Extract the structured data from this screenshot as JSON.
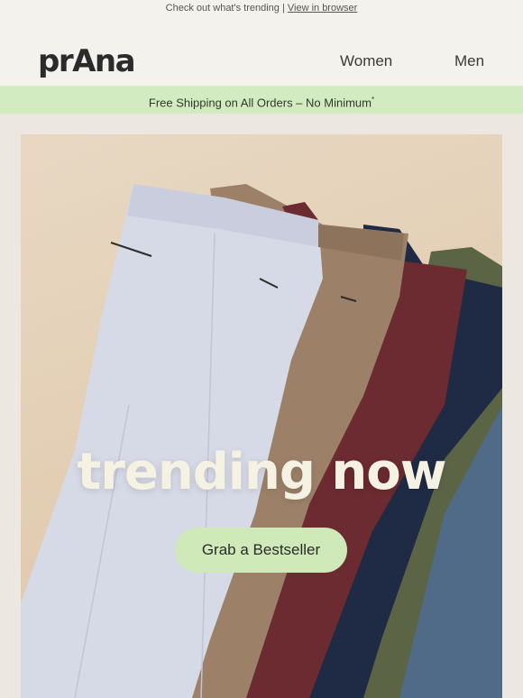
{
  "preheader": {
    "text": "Check out what's trending | ",
    "link": "View in browser"
  },
  "header": {
    "logo": "prAna",
    "nav": [
      "Women",
      "Men"
    ]
  },
  "banner": {
    "text": "Free Shipping on All Orders – No Minimum",
    "mark": "*"
  },
  "hero": {
    "title": "trending now",
    "cta": "Grab a Bestseller"
  },
  "colors": {
    "banner_bg": "#d3ebc1",
    "cta_bg": "#cfe9b9",
    "page_bg": "#f3f2ec",
    "pants": [
      "#d6d9e6",
      "#9c8168",
      "#6b2b30",
      "#1f2a44",
      "#5b6546",
      "#4f6b87"
    ]
  }
}
